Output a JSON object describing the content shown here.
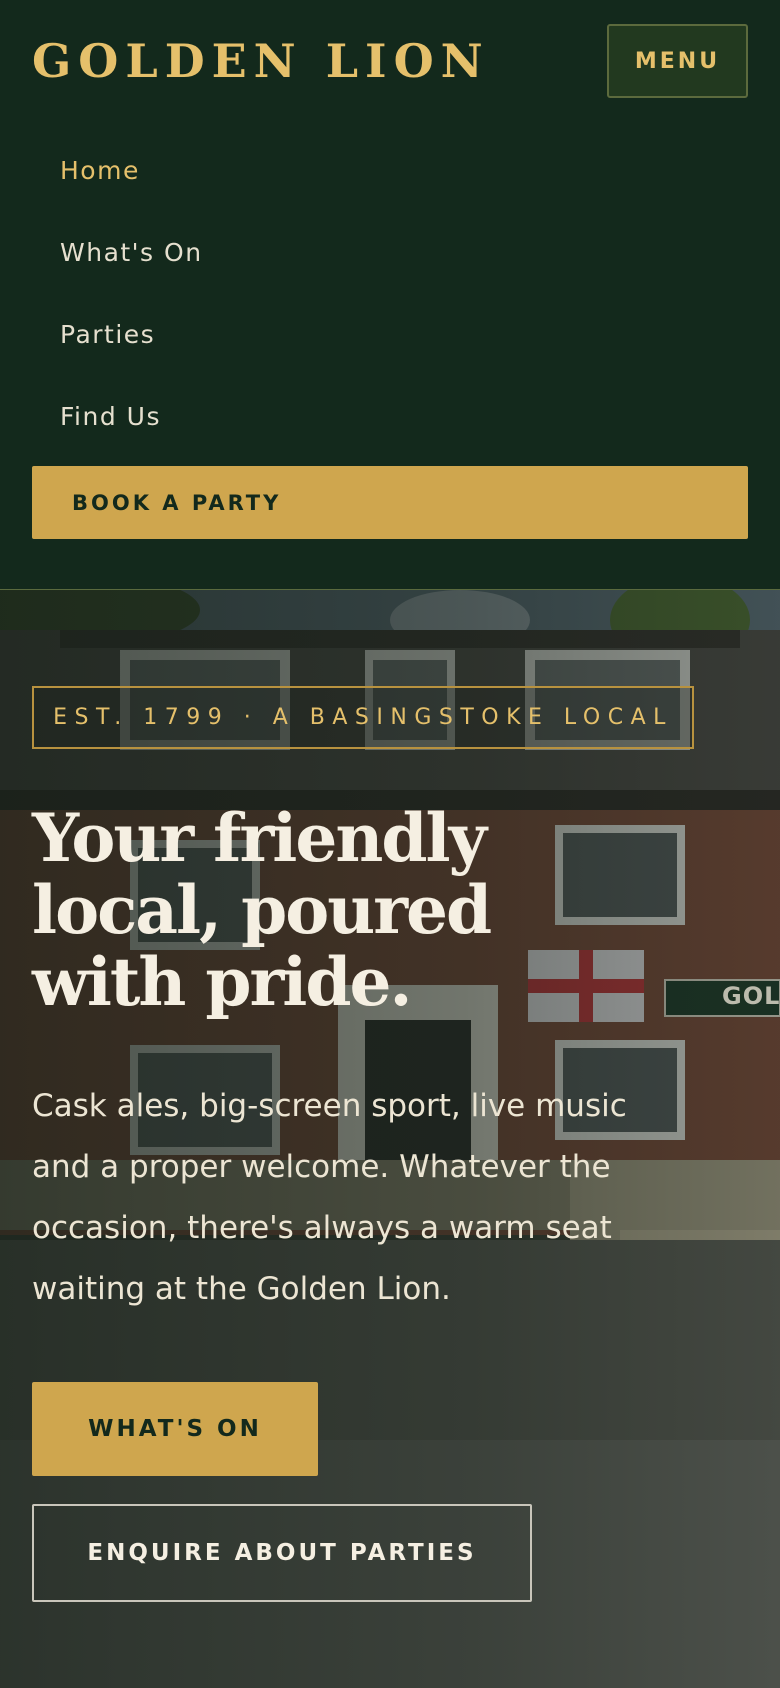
{
  "header": {
    "logo": "GOLDEN LION",
    "menu_label": "MENU"
  },
  "nav": {
    "items": [
      {
        "label": "Home",
        "active": true
      },
      {
        "label": "What's On",
        "active": false
      },
      {
        "label": "Parties",
        "active": false
      },
      {
        "label": "Find Us",
        "active": false
      }
    ],
    "cta": "BOOK A PARTY"
  },
  "hero": {
    "badge": "EST. 1799 · A BASINGSTOKE LOCAL",
    "title_lines": [
      "Your friendly",
      "local, poured",
      "with pride."
    ],
    "text_lines": [
      "Cask ales, big-screen sport, live music",
      "and a proper welcome. Whatever the",
      "occasion, there's always a warm seat",
      "waiting at the Golden Lion."
    ],
    "primary_button": "WHAT'S ON",
    "secondary_button": "ENQUIRE ABOUT PARTIES",
    "sign_text": "GOL"
  },
  "colors": {
    "background": "#13291c",
    "gold": "#cfa64e",
    "gold_text": "#e5c06b",
    "cream": "#f5efe2"
  }
}
